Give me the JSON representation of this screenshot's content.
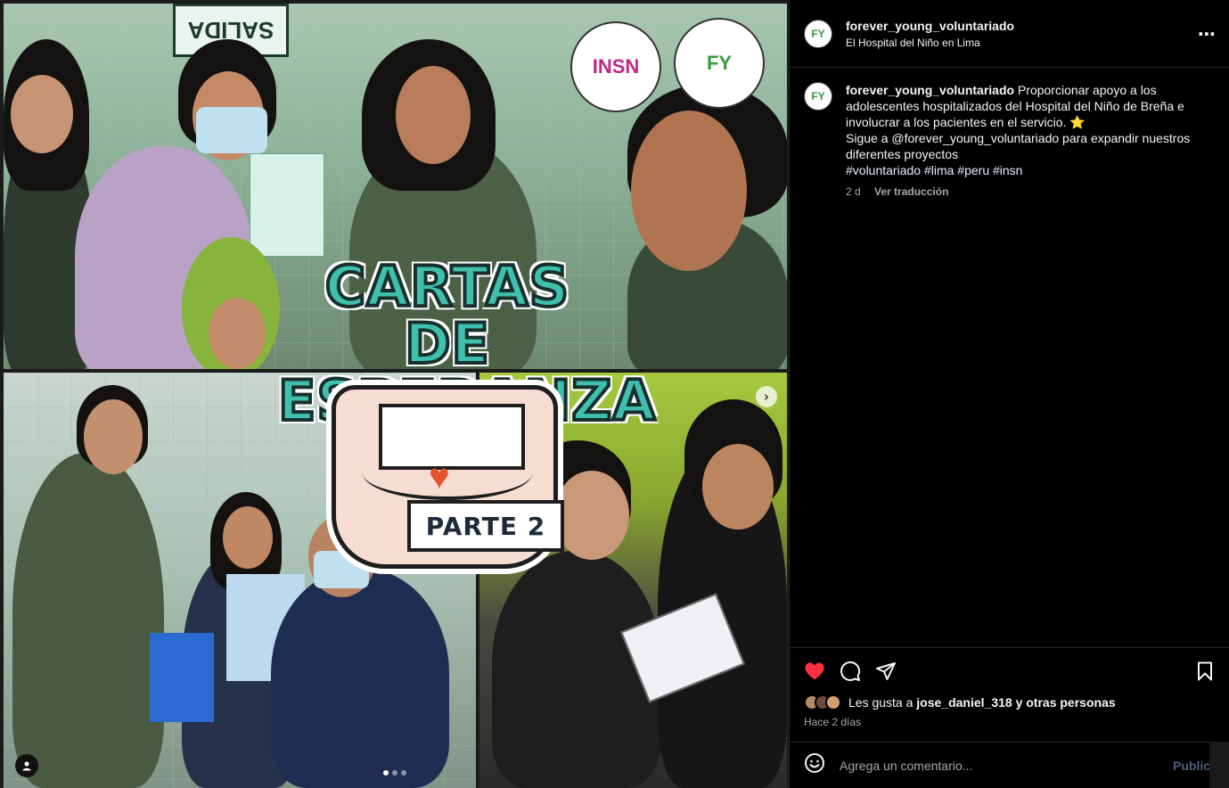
{
  "post": {
    "username": "forever_young_voluntariado",
    "location": "El Hospital del Niño en Lima",
    "caption_text": "Proporcionar apoyo a los adolescentes hospitalizados del Hospital del Niño de Breña e involucrar a los pacientes en el servicio. ⭐",
    "caption_follow": "Sigue a @forever_young_voluntariado para expandir nuestros diferentes proyectos",
    "hashtags": "#voluntariado #lima #peru #insn",
    "age_short": "2 d",
    "translate_label": "Ver traducción",
    "likes_prefix": "Les gusta a",
    "likes_user": "jose_daniel_318",
    "likes_suffix": "y otras personas",
    "posted_ago": "Hace 2 días",
    "avatar_initials": "FY",
    "more_symbol": "⋯"
  },
  "media": {
    "title_line1": "CARTAS DE",
    "title_line2": "ESPERANZA",
    "badge": "PARTE 2",
    "sign_text": "SALIDA",
    "logo_left": "INSN",
    "logo_right": "FY",
    "next_symbol": "›",
    "carousel_count": 3,
    "carousel_active": 0
  },
  "comment": {
    "placeholder": "Agrega un comentario...",
    "post_label": "Publicar"
  },
  "icons": {
    "like": "heart-icon",
    "comment": "comment-icon",
    "share": "share-icon",
    "save": "bookmark-icon",
    "emoji": "emoji-icon",
    "user_tag": "user-tag-icon",
    "more": "more-icon",
    "next": "chevron-right-icon"
  },
  "colors": {
    "like_active": "#ff3040",
    "title_fill": "#3fbfae",
    "heart_seal": "#e4532f"
  }
}
